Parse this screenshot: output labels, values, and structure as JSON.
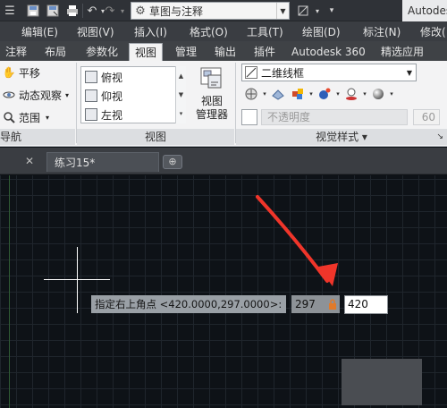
{
  "quick_access": {
    "workspace": "草图与注释",
    "app_title": "Autodesk"
  },
  "menubar": {
    "items": [
      "编辑(E)",
      "视图(V)",
      "插入(I)",
      "格式(O)",
      "工具(T)",
      "绘图(D)",
      "标注(N)",
      "修改("
    ]
  },
  "ribbon_tabs": {
    "items": [
      "注释",
      "布局",
      "参数化",
      "视图",
      "管理",
      "输出",
      "插件",
      "Autodesk 360",
      "精选应用"
    ],
    "active": "视图"
  },
  "nav_panel": {
    "pan": "平移",
    "orbit": "动态观察",
    "extents": "范围",
    "title": "导航"
  },
  "views_panel": {
    "views": [
      "俯视",
      "仰视",
      "左视"
    ],
    "manager_line1": "视图",
    "manager_line2": "管理器",
    "title": "视图"
  },
  "visual_styles_panel": {
    "style": "二维线框",
    "opacity_label": "不透明度",
    "opacity_value": "60",
    "title": "视觉样式 ▾"
  },
  "doc_tabs": {
    "active_tab": "练习15*"
  },
  "command": {
    "prompt": "指定右上角点 <420.0000,297.0000>:",
    "value1": "297",
    "value2": "420"
  },
  "colors": {
    "annotation_arrow": "#f0352a",
    "canvas_bg": "#0e1217",
    "grid": "#1f252c"
  }
}
